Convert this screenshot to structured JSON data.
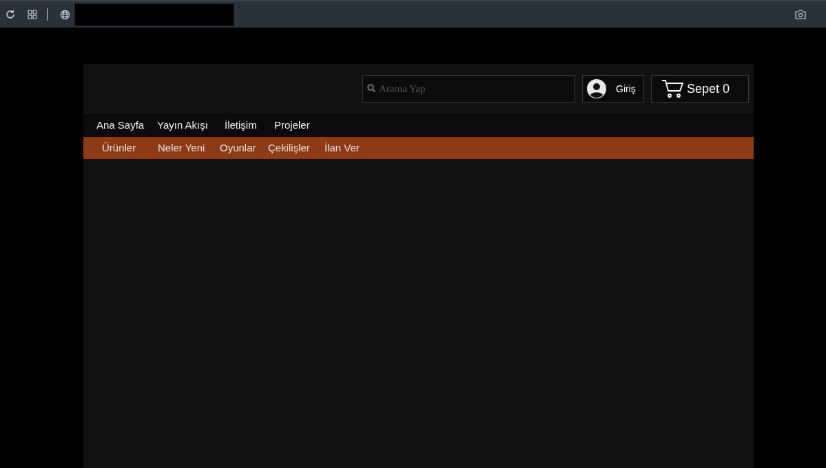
{
  "search": {
    "placeholder": "Arama Yap"
  },
  "login": {
    "label": "Giriş"
  },
  "cart": {
    "label": "Sepet",
    "count": "0"
  },
  "nav": [
    {
      "label": "Ana Sayfa"
    },
    {
      "label": "Yayın Akışı"
    },
    {
      "label": "İletişim"
    },
    {
      "label": "Projeler"
    }
  ],
  "subnav": [
    {
      "label": "Ürünler"
    },
    {
      "label": "Neler Yeni"
    },
    {
      "label": "Oyunlar"
    },
    {
      "label": "Çekilişler"
    },
    {
      "label": "İlan Ver"
    }
  ]
}
